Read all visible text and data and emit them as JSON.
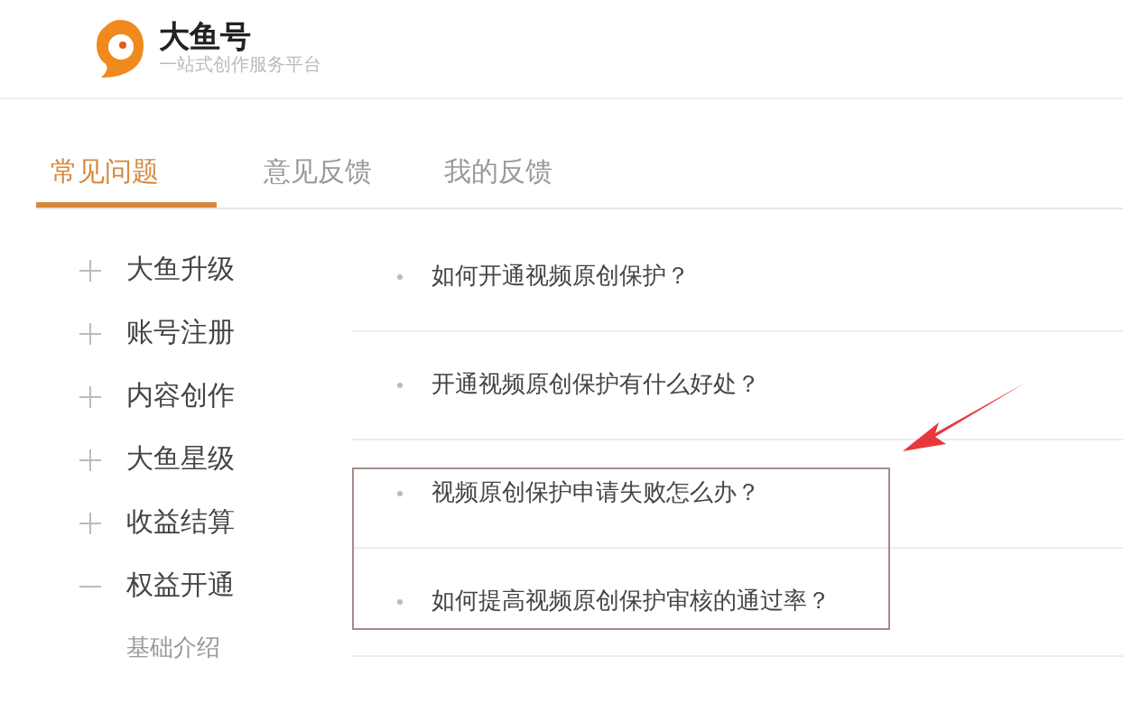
{
  "brand": {
    "name": "大鱼号",
    "tagline": "一站式创作服务平台"
  },
  "tabs": [
    {
      "label": "常见问题",
      "selected": true
    },
    {
      "label": "意见反馈",
      "selected": false
    },
    {
      "label": "我的反馈",
      "selected": false
    }
  ],
  "sidebar": {
    "items": [
      {
        "label": "大鱼升级",
        "expanded": false
      },
      {
        "label": "账号注册",
        "expanded": false
      },
      {
        "label": "内容创作",
        "expanded": false
      },
      {
        "label": "大鱼星级",
        "expanded": false
      },
      {
        "label": "收益结算",
        "expanded": false
      },
      {
        "label": "权益开通",
        "expanded": true,
        "children": [
          {
            "label": "基础介绍"
          }
        ]
      }
    ]
  },
  "questions": [
    {
      "text": "如何开通视频原创保护？",
      "highlighted": false
    },
    {
      "text": "开通视频原创保护有什么好处？",
      "highlighted": false
    },
    {
      "text": "视频原创保护申请失败怎么办？",
      "highlighted": true
    },
    {
      "text": "如何提高视频原创保护审核的通过率？",
      "highlighted": true
    }
  ]
}
